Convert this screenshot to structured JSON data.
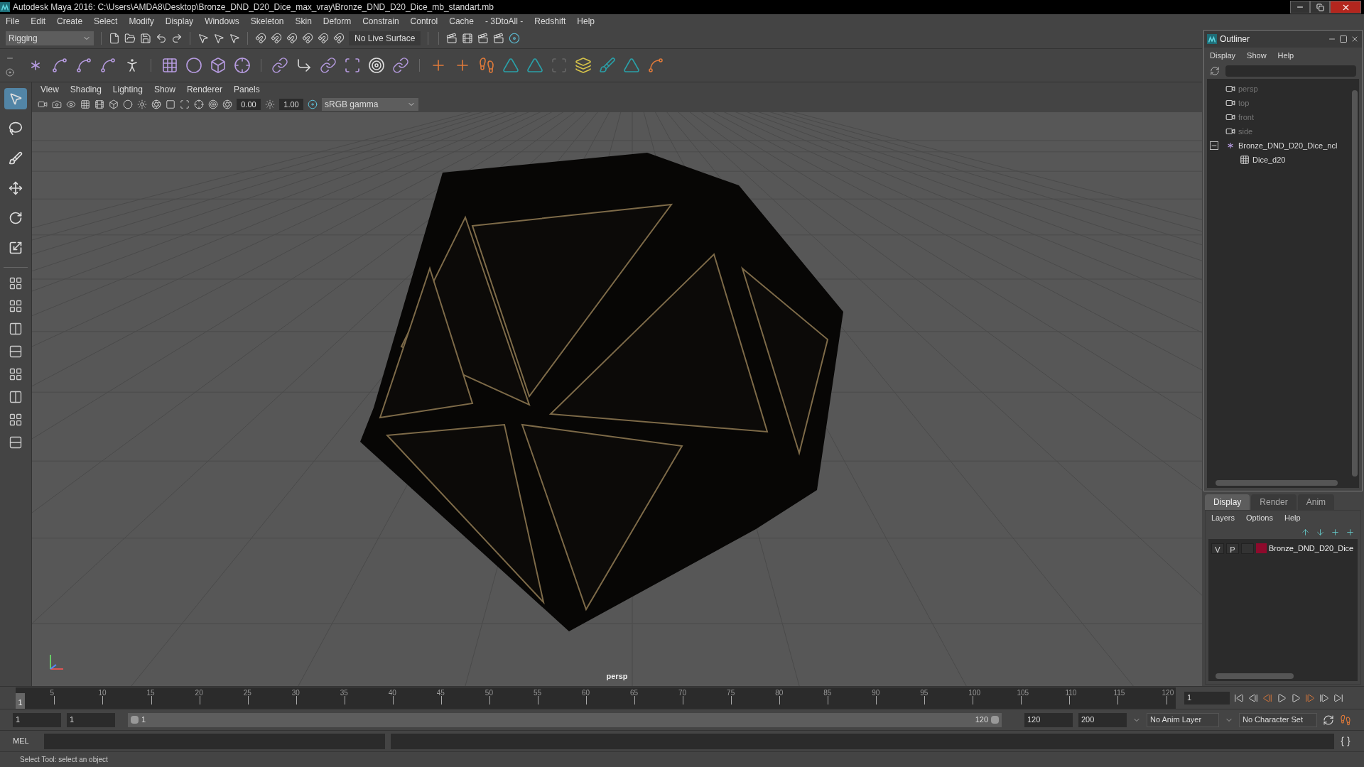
{
  "window": {
    "title": "Autodesk Maya 2016: C:\\Users\\AMDA8\\Desktop\\Bronze_DND_D20_Dice_max_vray\\Bronze_DND_D20_Dice_mb_standart.mb"
  },
  "menu_bar": [
    "File",
    "Edit",
    "Create",
    "Select",
    "Modify",
    "Display",
    "Windows",
    "Skeleton",
    "Skin",
    "Deform",
    "Constrain",
    "Control",
    "Cache",
    "- 3DtoAll -",
    "Redshift",
    "Help"
  ],
  "status_line": {
    "menu_set": "Rigging",
    "live_surface": "No Live Surface"
  },
  "toolbox": [
    {
      "kind": "select",
      "selected": true
    },
    {
      "kind": "lasso",
      "selected": false
    },
    {
      "kind": "paint",
      "selected": false
    },
    {
      "kind": "move",
      "selected": false
    },
    {
      "kind": "rotate",
      "selected": false
    },
    {
      "kind": "scale",
      "selected": false
    }
  ],
  "viewport": {
    "menu": [
      "View",
      "Shading",
      "Lighting",
      "Show",
      "Renderer",
      "Panels"
    ],
    "exposure": "0.00",
    "gamma": "1.00",
    "color_space": "sRGB gamma",
    "camera": "persp"
  },
  "outliner": {
    "title": "Outliner",
    "menu": [
      "Display",
      "Show",
      "Help"
    ],
    "items": [
      {
        "kind": "camera",
        "label": "persp",
        "hidden": true
      },
      {
        "kind": "camera",
        "label": "top",
        "hidden": true
      },
      {
        "kind": "camera",
        "label": "front",
        "hidden": true
      },
      {
        "kind": "camera",
        "label": "side",
        "hidden": true
      },
      {
        "kind": "group",
        "label": "Bronze_DND_D20_Dice_ncl",
        "hidden": false,
        "expanded": true,
        "children": [
          {
            "kind": "mesh",
            "label": "Dice_d20",
            "hidden": false
          }
        ]
      }
    ]
  },
  "layer_editor": {
    "tabs": [
      {
        "label": "Display",
        "selected": true
      },
      {
        "label": "Render",
        "selected": false
      },
      {
        "label": "Anim",
        "selected": false
      }
    ],
    "menu": [
      "Layers",
      "Options",
      "Help"
    ],
    "layers": [
      {
        "visible": "V",
        "playback": "P",
        "color": "#8e0a2c",
        "name": "Bronze_DND_D20_Dice"
      }
    ]
  },
  "time_slider": {
    "current_frame": "1",
    "level": 0,
    "ticks": [
      "5",
      "10",
      "15",
      "20",
      "25",
      "30",
      "35",
      "40",
      "45",
      "50",
      "55",
      "60",
      "65",
      "70",
      "75",
      "80",
      "85",
      "90",
      "95",
      "100",
      "105",
      "110",
      "115",
      "120"
    ],
    "frame_field": "1"
  },
  "range_slider": {
    "level": 1,
    "start": "1",
    "playback_start": "1",
    "slider_start": "1",
    "slider_end": "120",
    "playback_end": "120",
    "end": "200",
    "anim_layer": "No Anim Layer",
    "character_set": "No Character Set"
  },
  "command_line": {
    "language": "MEL"
  },
  "help_line": "Select Tool: select an object"
}
